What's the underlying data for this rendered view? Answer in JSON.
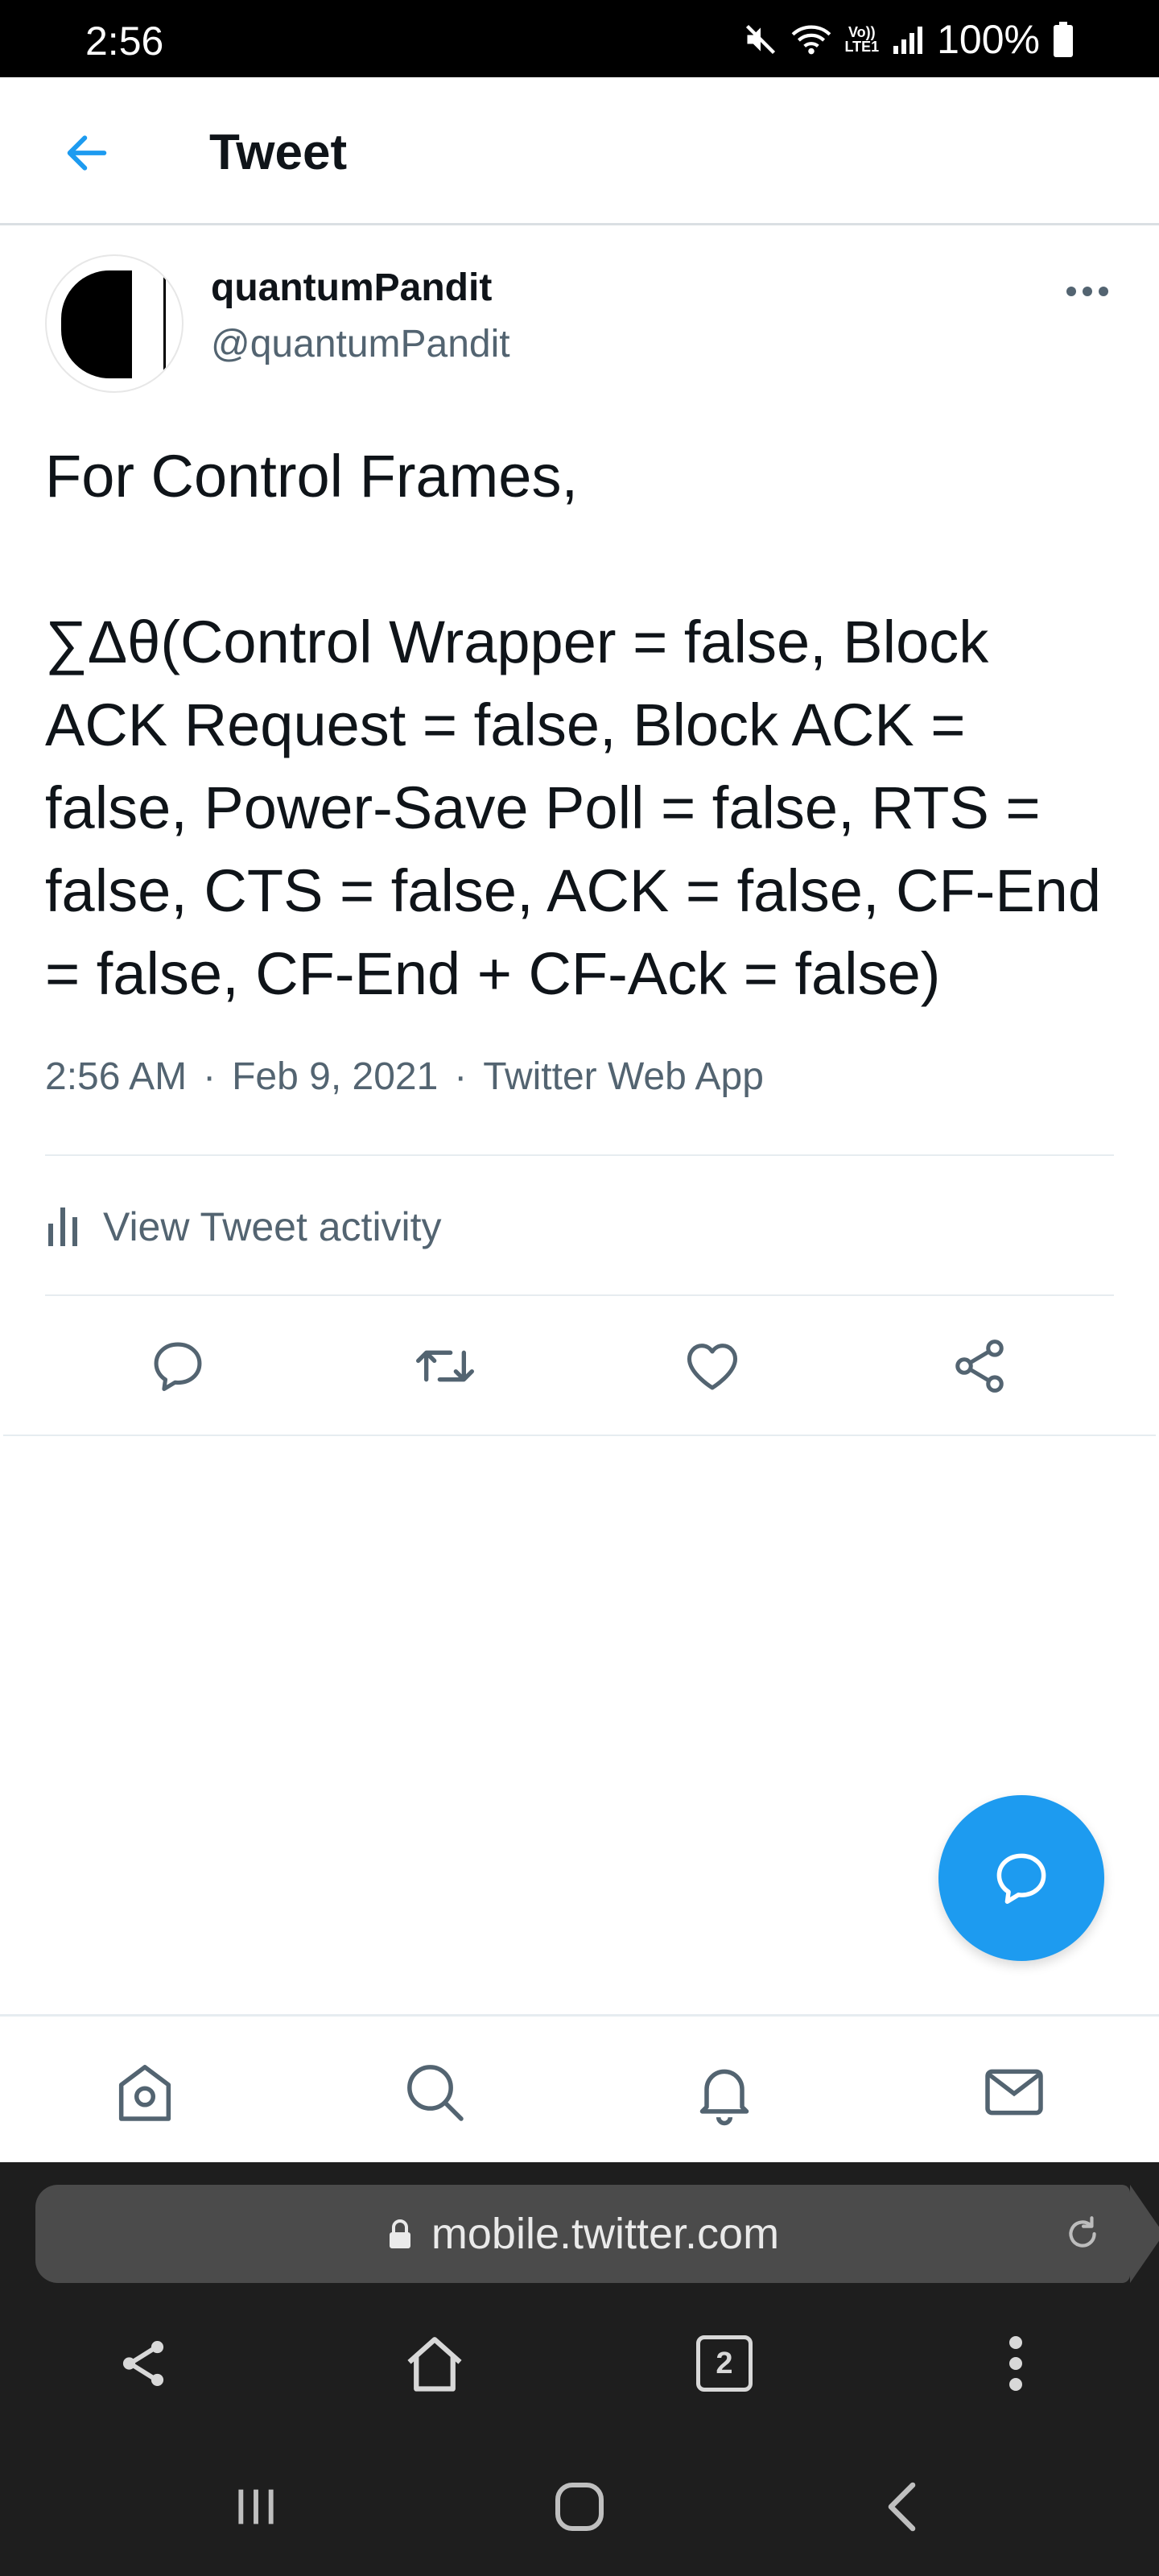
{
  "status_bar": {
    "time": "2:56",
    "lte_label_top": "Vo))",
    "lte_label_bottom": "LTE1",
    "battery": "100%"
  },
  "header": {
    "title": "Tweet"
  },
  "tweet": {
    "display_name": "quantumPandit",
    "handle": "@quantumPandit",
    "text_line1": "For Control Frames,",
    "text_body": "∑Δθ(Control Wrapper = false, Block ACK Request = false, Block ACK = false, Power-Save Poll = false, RTS = false, CTS = false, ACK = false, CF-End = false, CF-End + CF-Ack = false)",
    "time": "2:56 AM",
    "date": "Feb 9, 2021",
    "separator": "·",
    "source": "Twitter Web App",
    "activity_label": "View Tweet activity"
  },
  "icons": {
    "back": "arrow-left-icon",
    "more": "more-horizontal-icon",
    "reply": "reply-icon",
    "retweet": "retweet-icon",
    "like": "heart-icon",
    "share": "share-icon",
    "compose": "compose-reply-icon",
    "home": "home-icon",
    "search": "search-icon",
    "notifications": "bell-icon",
    "messages": "mail-icon"
  },
  "browser": {
    "url": "mobile.twitter.com",
    "tab_count": "2"
  },
  "colors": {
    "accent": "#1d9bf0",
    "secondary_text": "#536471",
    "browser_bg": "#1e1e1e"
  }
}
